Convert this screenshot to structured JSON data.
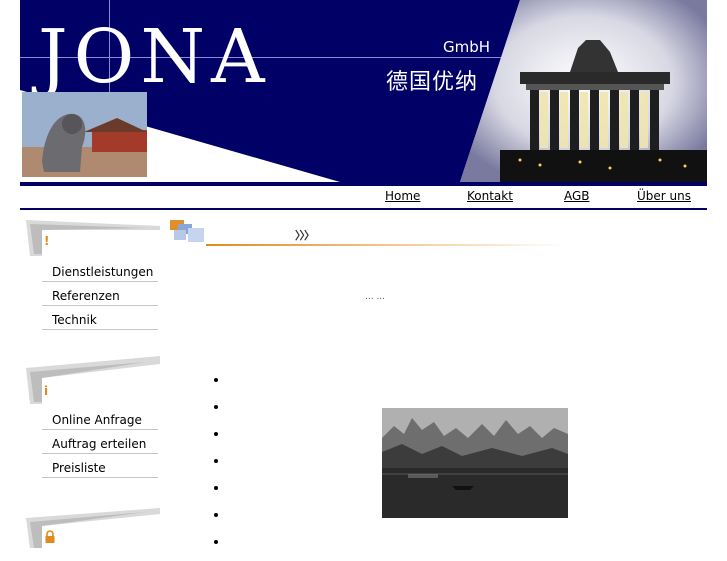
{
  "banner": {
    "logo_text": "JONA",
    "company_suffix": "GmbH",
    "chinese_name": "德国优纳",
    "colors": {
      "navy": "#000066",
      "white": "#ffffff"
    }
  },
  "nav": {
    "items": [
      {
        "label": "Home"
      },
      {
        "label": "Kontakt"
      },
      {
        "label": "AGB"
      },
      {
        "label": "Über uns"
      }
    ]
  },
  "sidebar": {
    "sections": [
      {
        "icon": "exclamation-icon",
        "icon_glyph": "!",
        "items": [
          "Dienstleistungen",
          "Referenzen",
          "Technik"
        ]
      },
      {
        "icon": "info-icon",
        "icon_glyph": "i",
        "items": [
          "Online Anfrage",
          "Auftrag erteilen",
          "Preisliste"
        ]
      },
      {
        "icon": "lock-icon",
        "icon_glyph": "🔒",
        "items": []
      }
    ],
    "accent_color": "#e08a1e"
  },
  "content": {
    "title": "〉〉〉",
    "dots": "... ...",
    "bullet_count": 7
  }
}
